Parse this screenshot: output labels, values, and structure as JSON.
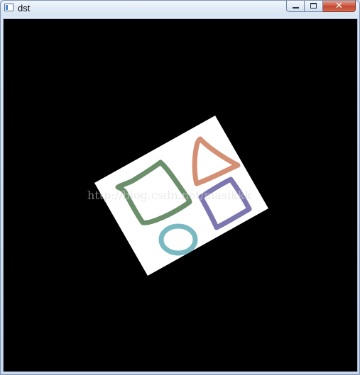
{
  "window": {
    "title": "dst",
    "icons": {
      "app": "app-window-icon",
      "minimize": "minimize-icon",
      "maximize": "maximize-icon",
      "close": "close-icon"
    },
    "close_glyph": "✕"
  },
  "canvas": {
    "background": "#000000",
    "paper_color": "#ffffff",
    "shapes": [
      {
        "name": "square-green",
        "color": "#6b8f6b"
      },
      {
        "name": "triangle-orange",
        "color": "#d49074"
      },
      {
        "name": "square-purple",
        "color": "#7c77b0"
      },
      {
        "name": "circle-teal",
        "color": "#7ab9c1"
      }
    ],
    "watermark": "http://blog.csdn.net/masikkk"
  }
}
